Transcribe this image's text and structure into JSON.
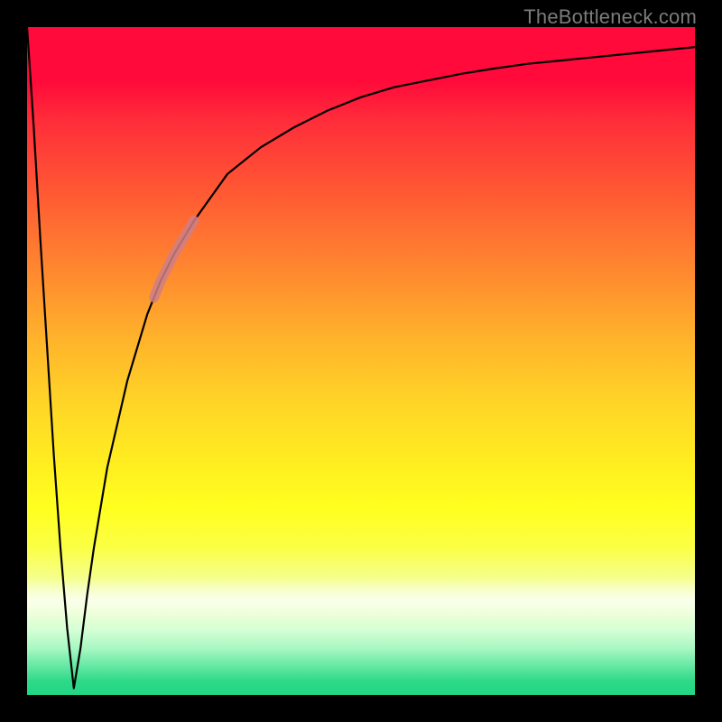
{
  "watermark": "TheBottleneck.com",
  "colors": {
    "frame": "#000000",
    "curve": "#000000",
    "highlight": "#cf7f85",
    "gradient_top": "#ff0a3a",
    "gradient_bottom": "#20d884"
  },
  "chart_data": {
    "type": "line",
    "title": "",
    "xlabel": "",
    "ylabel": "",
    "xlim": [
      0,
      100
    ],
    "ylim": [
      0,
      100
    ],
    "grid": false,
    "legend": false,
    "notes": "Vertical gradient background runs red (top, high bottleneck) to yellow (middle) to green (bottom, low bottleneck). Curve plunges from ~100 at x≈0 to ~0 near x≈7 then rises asymptotically toward ~97. Short thick rosy highlight stroke overlays the curve roughly over x≈19–25.",
    "series": [
      {
        "name": "bottleneck-curve",
        "x": [
          0,
          1,
          2,
          3,
          4,
          5,
          6,
          7,
          8,
          9,
          10,
          12,
          15,
          18,
          20,
          22,
          25,
          30,
          35,
          40,
          45,
          50,
          55,
          60,
          65,
          70,
          75,
          80,
          85,
          90,
          95,
          100
        ],
        "values": [
          100,
          85,
          68,
          52,
          36,
          22,
          10,
          1,
          7,
          15,
          22,
          34,
          47,
          57,
          62,
          66,
          71,
          78,
          82,
          85,
          87.5,
          89.5,
          91,
          92,
          93,
          93.8,
          94.5,
          95,
          95.5,
          96,
          96.5,
          97
        ]
      }
    ],
    "highlight_segment": {
      "x_start": 19,
      "x_end": 25
    }
  }
}
